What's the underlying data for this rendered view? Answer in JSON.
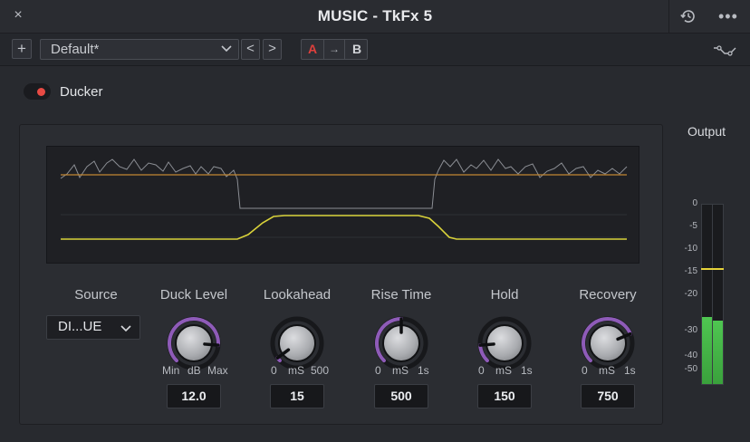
{
  "titlebar": {
    "title": "MUSIC - TkFx 5",
    "close_icon": "×",
    "more_icon": "•••"
  },
  "toolbar": {
    "add_label": "+",
    "preset_value": "Default*",
    "prev_label": "<",
    "next_label": ">",
    "ab": {
      "a": "A",
      "copy": "→",
      "b": "B"
    }
  },
  "plugin": {
    "name": "Ducker",
    "enabled": true
  },
  "source": {
    "title": "Source",
    "value": "DI...UE"
  },
  "knobs": [
    {
      "title": "Duck Level",
      "min": "Min",
      "unit": "dB",
      "max": "Max",
      "value": "12.0",
      "level": 0.85
    },
    {
      "title": "Lookahead",
      "min": "0",
      "unit": "mS",
      "max": "500",
      "value": "15",
      "level": 0.03
    },
    {
      "title": "Rise Time",
      "min": "0",
      "unit": "mS",
      "max": "1s",
      "value": "500",
      "level": 0.5
    },
    {
      "title": "Hold",
      "min": "0",
      "unit": "mS",
      "max": "1s",
      "value": "150",
      "level": 0.15
    },
    {
      "title": "Recovery",
      "min": "0",
      "unit": "mS",
      "max": "1s",
      "value": "750",
      "level": 0.75
    }
  ],
  "output": {
    "title": "Output",
    "scale": [
      "0",
      "-5",
      "-10",
      "-15",
      "-20",
      "-30",
      "-40",
      "-50"
    ],
    "left_level_db": -26,
    "right_level_db": -27,
    "peak_db": -14
  },
  "colors": {
    "accent_purple": "#8e5bb8",
    "bypass_red": "#e84a44",
    "ab_red": "#e0403c",
    "threshold_orange": "#c28733",
    "gain_yellow": "#d9d23a",
    "meter_green": "#4fc651"
  }
}
